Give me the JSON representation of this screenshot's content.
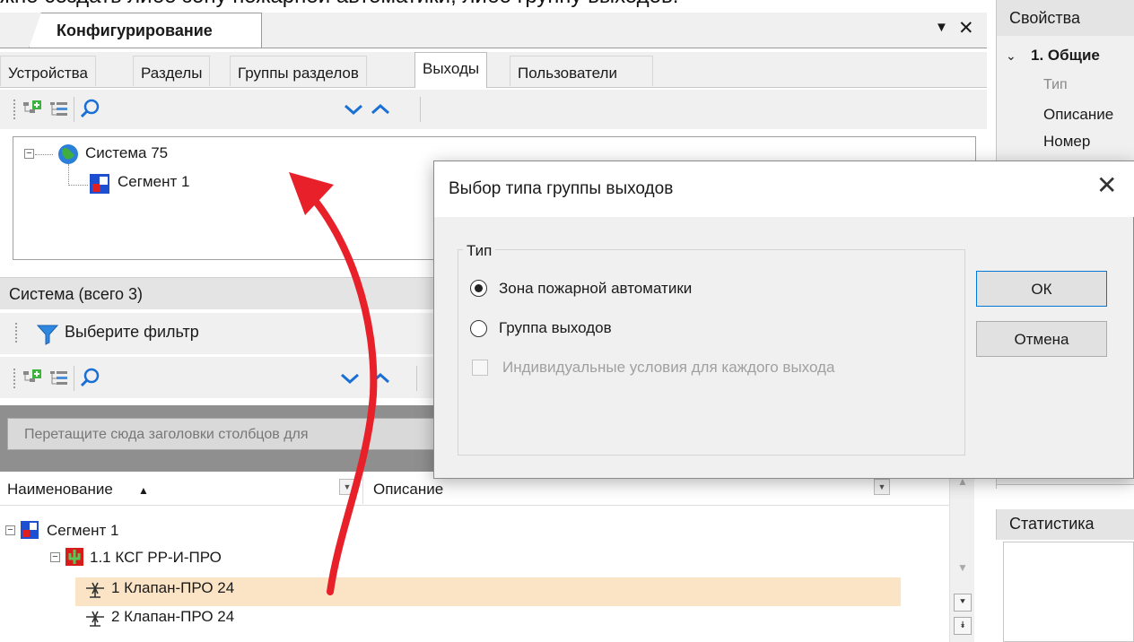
{
  "caption": {
    "text": "жно создать либо зону пожарной автоматики, либо группу выходов."
  },
  "config_panel": {
    "title": "Конфигурирование",
    "tabs": [
      "Устройства",
      "Разделы",
      "Группы разделов",
      "Выходы",
      "Пользователи"
    ],
    "active_tab": "Выходы"
  },
  "tree": {
    "root": "Система 75",
    "child": "Сегмент 1"
  },
  "system_panel": {
    "title": "Система (всего 3)",
    "filter_label": "Выберите фильтр",
    "group_by_hint": "Перетащите сюда заголовки столбцов для",
    "columns": {
      "name": "Наименование",
      "description": "Описание"
    },
    "rows": [
      {
        "label": "Сегмент 1"
      },
      {
        "label": "1.1 КСГ РР-И-ПРО"
      },
      {
        "label": "1 Клапан-ПРО 24",
        "highlighted": true
      },
      {
        "label": "2 Клапан-ПРО 24"
      }
    ]
  },
  "properties_panel": {
    "title": "Свойства",
    "section": "1. Общие",
    "items": [
      "Тип",
      "Описание",
      "Номер"
    ]
  },
  "statistics_panel": {
    "title": "Статистика"
  },
  "dialog": {
    "title": "Выбор типа группы выходов",
    "group_label": "Тип",
    "options": [
      {
        "label": "Зона пожарной автоматики",
        "checked": true
      },
      {
        "label": "Группа выходов",
        "checked": false
      }
    ],
    "checkbox_label": "Индивидуальные условия для каждого выхода",
    "checkbox_enabled": false,
    "ok_label": "ОК",
    "cancel_label": "Отмена"
  },
  "colors": {
    "annotation_arrow": "#e8202a",
    "highlight_row": "#fbe3c6",
    "panel_bg": "#f0f0f0",
    "accent_blue": "#1a6fd4"
  },
  "icons": [
    "add-device-icon",
    "tree-view-icon",
    "search-icon",
    "expand-down-icon",
    "collapse-up-icon",
    "globe-icon",
    "segment-icon",
    "funnel-icon",
    "valve-icon",
    "controller-icon"
  ]
}
